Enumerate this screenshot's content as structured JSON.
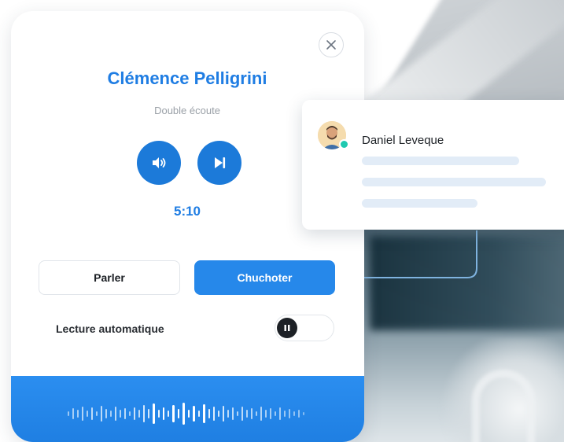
{
  "caller": {
    "name": "Clémence Pelligrini",
    "status": "Double écoute",
    "timer": "5:10"
  },
  "controls": {
    "volume_icon": "speaker-icon",
    "next_icon": "skip-next-icon",
    "close_icon": "close-icon"
  },
  "modes": {
    "speak_label": "Parler",
    "whisper_label": "Chuchoter",
    "active": "Chuchoter"
  },
  "autoplay": {
    "label": "Lecture automatique",
    "state": "paused"
  },
  "participant": {
    "name": "Daniel Leveque",
    "status_color": "#1ec9b0"
  },
  "colors": {
    "accent": "#1f7de3",
    "button_active": "#2688ea",
    "footer": "#2386ea"
  }
}
